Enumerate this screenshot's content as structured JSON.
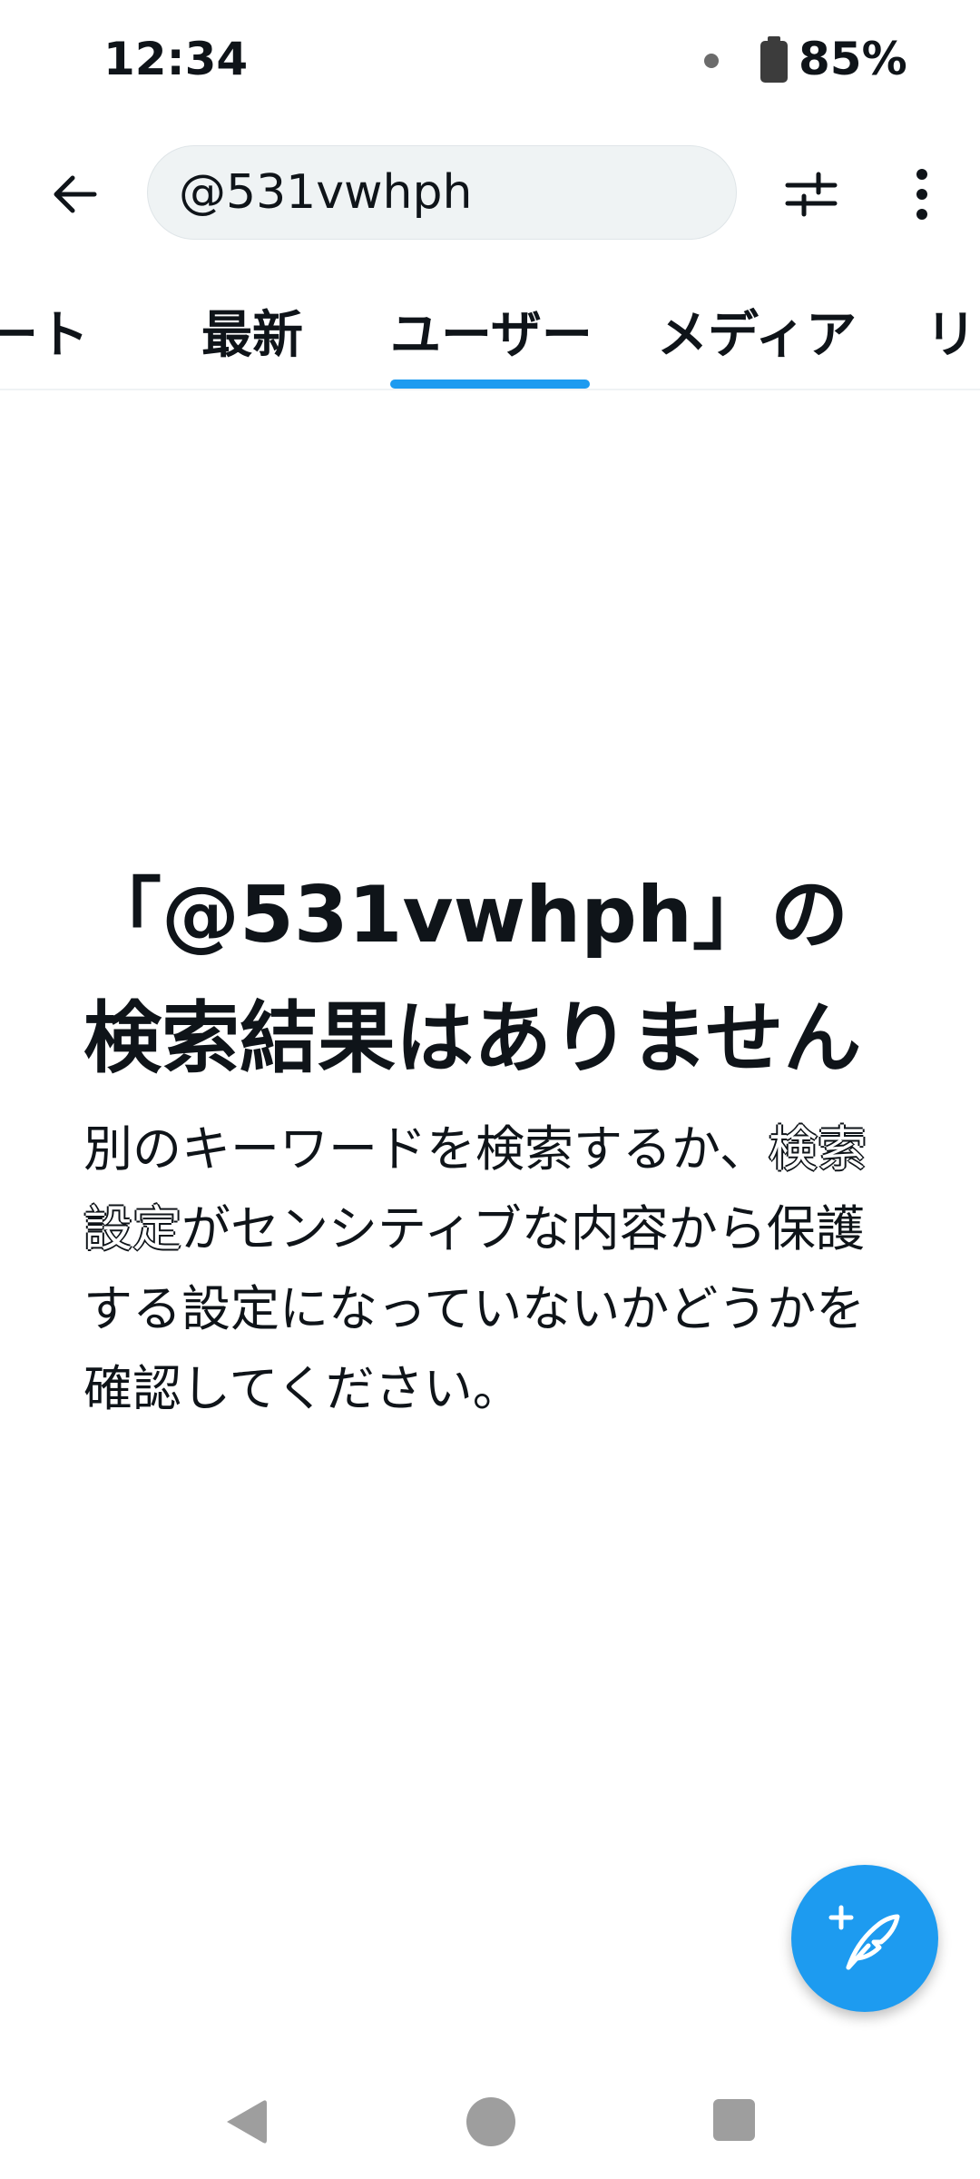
{
  "status_bar": {
    "time": "12:34",
    "battery": "85%"
  },
  "search": {
    "query": "@531vwhph"
  },
  "tabs": [
    {
      "label": "ツイート"
    },
    {
      "label": "最新"
    },
    {
      "label": "ユーザー",
      "selected": true
    },
    {
      "label": "メディア"
    },
    {
      "label": "リスト"
    }
  ],
  "empty_state": {
    "title": "「@531vwhph」の検索結果はありません",
    "body_prefix": "別のキーワードを検索するか、",
    "body_link": "検索設定",
    "body_suffix": "がセンシティブな内容から保護する設定になっていないかどうかを確認してください。"
  },
  "icons": {
    "back": "arrow-left-icon",
    "filter": "sliders-icon",
    "more": "more-vertical-icon",
    "compose": "compose-feather-icon",
    "battery": "battery-icon"
  },
  "colors": {
    "accent": "#1d9bf0",
    "text": "#0f1419",
    "search_bg": "#eff3f4"
  }
}
